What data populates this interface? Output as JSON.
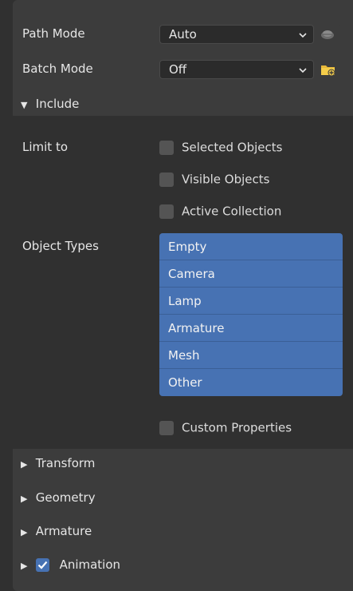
{
  "path_mode": {
    "label": "Path Mode",
    "value": "Auto"
  },
  "batch_mode": {
    "label": "Batch Mode",
    "value": "Off"
  },
  "include": {
    "title": "Include",
    "limit_to": {
      "label": "Limit to",
      "options": [
        {
          "label": "Selected Objects",
          "checked": false
        },
        {
          "label": "Visible Objects",
          "checked": false
        },
        {
          "label": "Active Collection",
          "checked": false
        }
      ]
    },
    "object_types": {
      "label": "Object Types",
      "items": [
        "Empty",
        "Camera",
        "Lamp",
        "Armature",
        "Mesh",
        "Other"
      ]
    },
    "custom_properties": {
      "label": "Custom Properties",
      "checked": false
    }
  },
  "sections": [
    "Transform",
    "Geometry",
    "Armature"
  ],
  "animation": {
    "label": "Animation",
    "checked": true
  },
  "colors": {
    "accent": "#4772b3",
    "panel": "#3c3c3c",
    "subpanel": "#303030"
  }
}
